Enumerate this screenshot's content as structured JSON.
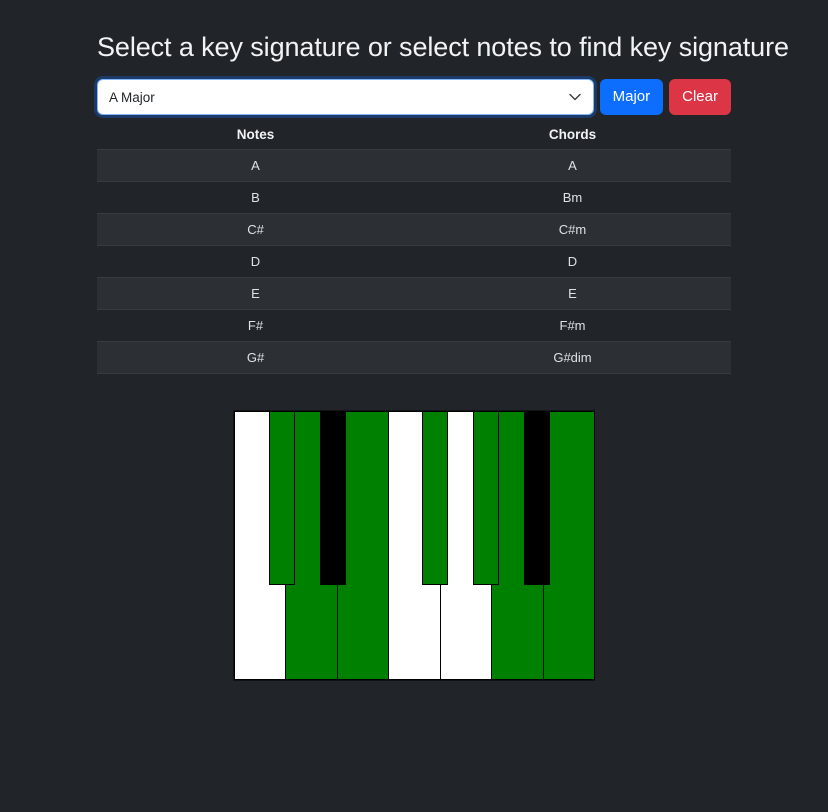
{
  "header": {
    "title": "Select a key signature or select notes to find key signature"
  },
  "controls": {
    "select": {
      "value": "A Major",
      "options": [
        "A Major"
      ],
      "caret_icon": "chevron-down-icon"
    },
    "major_button": "Major",
    "clear_button": "Clear"
  },
  "table": {
    "headers": {
      "notes": "Notes",
      "chords": "Chords"
    },
    "rows": [
      {
        "note": "A",
        "chord": "A"
      },
      {
        "note": "B",
        "chord": "Bm"
      },
      {
        "note": "C#",
        "chord": "C#m"
      },
      {
        "note": "D",
        "chord": "D"
      },
      {
        "note": "E",
        "chord": "E"
      },
      {
        "note": "F#",
        "chord": "F#m"
      },
      {
        "note": "G#",
        "chord": "G#dim"
      }
    ]
  },
  "piano": {
    "selected_color": "#008000",
    "white_key_color": "#ffffff",
    "black_key_color": "#000000",
    "white_keys": [
      {
        "name": "C",
        "selected": false
      },
      {
        "name": "D",
        "selected": true
      },
      {
        "name": "E",
        "selected": true
      },
      {
        "name": "F",
        "selected": false
      },
      {
        "name": "G",
        "selected": false
      },
      {
        "name": "A",
        "selected": true
      },
      {
        "name": "B",
        "selected": true
      }
    ],
    "black_keys": [
      {
        "name": "C#",
        "selected": true,
        "left_pct": 9.7,
        "width_pct": 7.2
      },
      {
        "name": "D#",
        "selected": false,
        "left_pct": 24.0,
        "width_pct": 7.2
      },
      {
        "name": "F#",
        "selected": true,
        "left_pct": 52.2,
        "width_pct": 7.2
      },
      {
        "name": "G#",
        "selected": true,
        "left_pct": 66.4,
        "width_pct": 7.2
      },
      {
        "name": "A#",
        "selected": false,
        "left_pct": 80.6,
        "width_pct": 7.2
      }
    ]
  },
  "colors": {
    "background": "#212529",
    "accent_primary": "#0d6efd",
    "accent_danger": "#dc3545",
    "row_stripe": "#2c3034",
    "selected_key": "#008000"
  }
}
